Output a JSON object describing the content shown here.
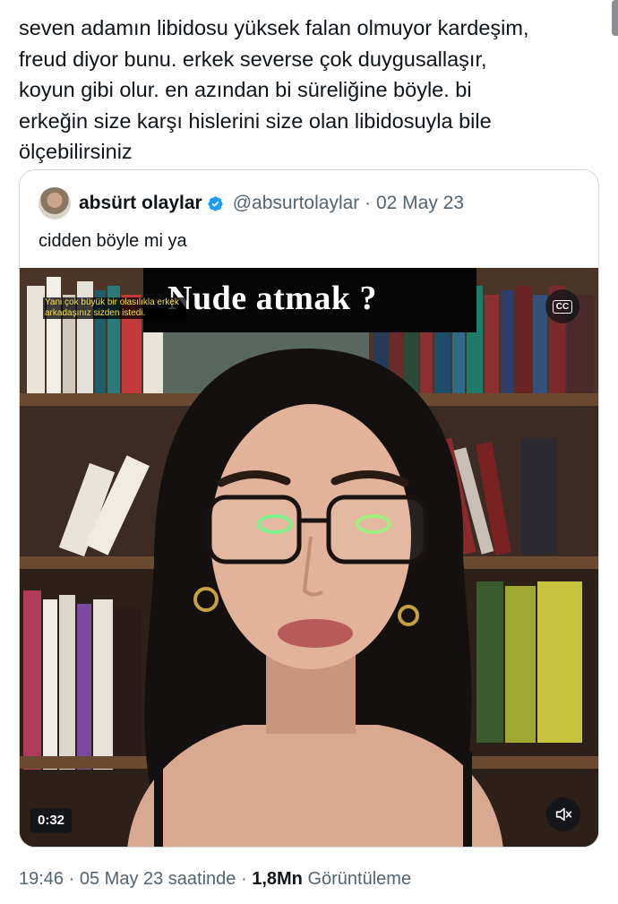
{
  "tweet": {
    "text": "seven adamın libidosu yüksek falan olmuyor kardeşim,\nfreud diyor bunu. erkek severse çok duygusallaşır,\nkoyun gibi olur. en azından bi süreliğine böyle. bi\nerkeğin size karşı hislerini size olan libidosuyla bile\nölçebilirsiniz"
  },
  "quote": {
    "author_name": "absürt olaylar",
    "handle": "@absurtolaylar",
    "separator": "·",
    "date": "02 May 23",
    "text": "cidden böyle mi ya",
    "video": {
      "subtitle_main": "Nude atmak ?",
      "subtitle_small": "Yani çok büyük bir olasılıkla erkek arkadaşınız sizden istedi.",
      "cc_label": "CC",
      "duration": "0:32",
      "muted": true
    }
  },
  "meta": {
    "time": "19:46",
    "sep1": "·",
    "date_text": "05 May 23 saatinde",
    "sep2": "·",
    "views_count": "1,8Mn",
    "views_label": "Görüntüleme"
  },
  "colors": {
    "text": "#0f1419",
    "secondary": "#536471",
    "verified": "#1d9bf0",
    "border": "#cfd9de"
  },
  "icons": [
    "verified-badge-icon",
    "closed-captions-icon",
    "speaker-muted-icon"
  ]
}
